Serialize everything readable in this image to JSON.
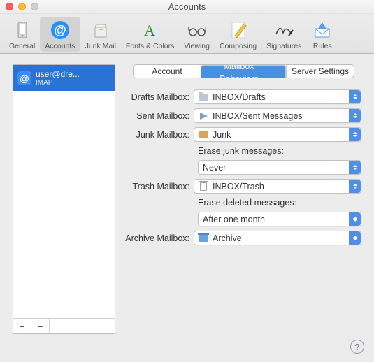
{
  "window": {
    "title": "Accounts"
  },
  "toolbar": {
    "items": [
      {
        "label": "General"
      },
      {
        "label": "Accounts"
      },
      {
        "label": "Junk Mail"
      },
      {
        "label": "Fonts & Colors"
      },
      {
        "label": "Viewing"
      },
      {
        "label": "Composing"
      },
      {
        "label": "Signatures"
      },
      {
        "label": "Rules"
      }
    ],
    "active_index": 1
  },
  "sidebar": {
    "accounts": [
      {
        "name": "user@dre...",
        "protocol": "IMAP",
        "icon": "@"
      }
    ],
    "add_label": "+",
    "remove_label": "−"
  },
  "tabs": {
    "items": [
      "Account Information",
      "Mailbox Behaviors",
      "Server Settings"
    ],
    "selected_index": 1
  },
  "form": {
    "drafts": {
      "label": "Drafts Mailbox:",
      "value": "INBOX/Drafts",
      "icon": "folder"
    },
    "sent": {
      "label": "Sent Mailbox:",
      "value": "INBOX/Sent Messages",
      "icon": "sent"
    },
    "junk": {
      "label": "Junk Mailbox:",
      "value": "Junk",
      "icon": "junk"
    },
    "erase_junk": {
      "label": "Erase junk messages:",
      "value": "Never"
    },
    "trash": {
      "label": "Trash Mailbox:",
      "value": "INBOX/Trash",
      "icon": "trash"
    },
    "erase_deleted": {
      "label": "Erase deleted messages:",
      "value": "After one month"
    },
    "archive": {
      "label": "Archive Mailbox:",
      "value": "Archive",
      "icon": "archive"
    }
  },
  "help": {
    "label": "?"
  }
}
